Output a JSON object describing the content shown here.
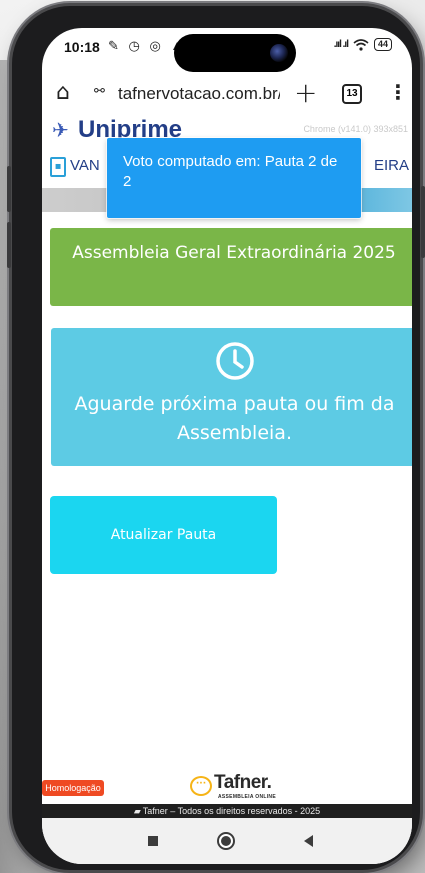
{
  "status_bar": {
    "time": "10:18",
    "notification_icons": "✎ ◷ ◎ ▲",
    "signal": ".ııl .ıl",
    "wifi": "wifi-icon",
    "battery": "44"
  },
  "browser": {
    "url": "tafnervotacao.com.br/",
    "tab_count": "13",
    "home_icon": "⌂",
    "site_settings_icon": "⚯",
    "new_tab_icon": "+",
    "menu_icon": "⋮"
  },
  "site": {
    "logo_text": "Uniprime",
    "chrome_version": "Chrome (v141.0) 393x851",
    "nav_left": "VAN",
    "nav_right": "EIRA"
  },
  "toast": {
    "message": "Voto computado em: Pauta 2 de 2"
  },
  "assembly": {
    "title": "Assembleia Geral Extraordinária 2025"
  },
  "waiting": {
    "message": "Aguarde próxima pauta ou fim da Assembleia."
  },
  "actions": {
    "update_label": "Atualizar Pauta"
  },
  "footer": {
    "env_badge": "Homologação",
    "brand": "Tafner.",
    "brand_sub": "ASSEMBLEIA ONLINE",
    "rights": "Tafner – Todos os direitos reservados - 2025"
  },
  "colors": {
    "green_card": "#7ab648",
    "cyan_card": "#5dcbe4",
    "button": "#1bd6f0",
    "toast": "#1e9cf2",
    "brand_blue": "#233e87",
    "badge": "#ef4a23"
  }
}
